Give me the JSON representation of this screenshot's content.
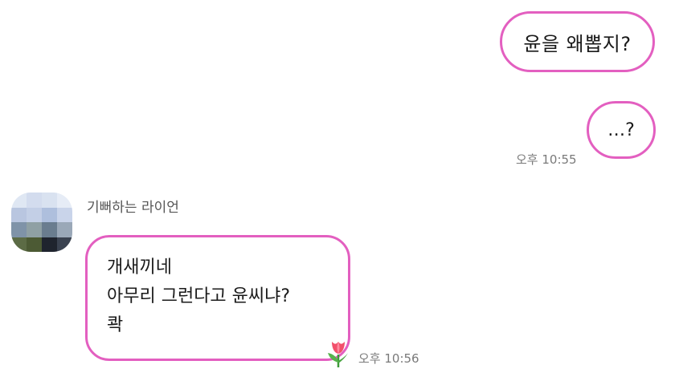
{
  "messages": {
    "sent_1": "윤을 왜뽑지?",
    "sent_2": "…?",
    "sent_time": "오후 10:55",
    "sender_name": "기뻐하는 라이언",
    "received_lines": [
      "개새끼네",
      "아무리 그런다고 윤씨냐?",
      "콱"
    ],
    "received_time": "오후 10:56"
  },
  "colors": {
    "bubble_border": "#e35fc0",
    "time_text": "#7a7a7a"
  },
  "icons": {
    "reaction": "tulip-icon"
  }
}
